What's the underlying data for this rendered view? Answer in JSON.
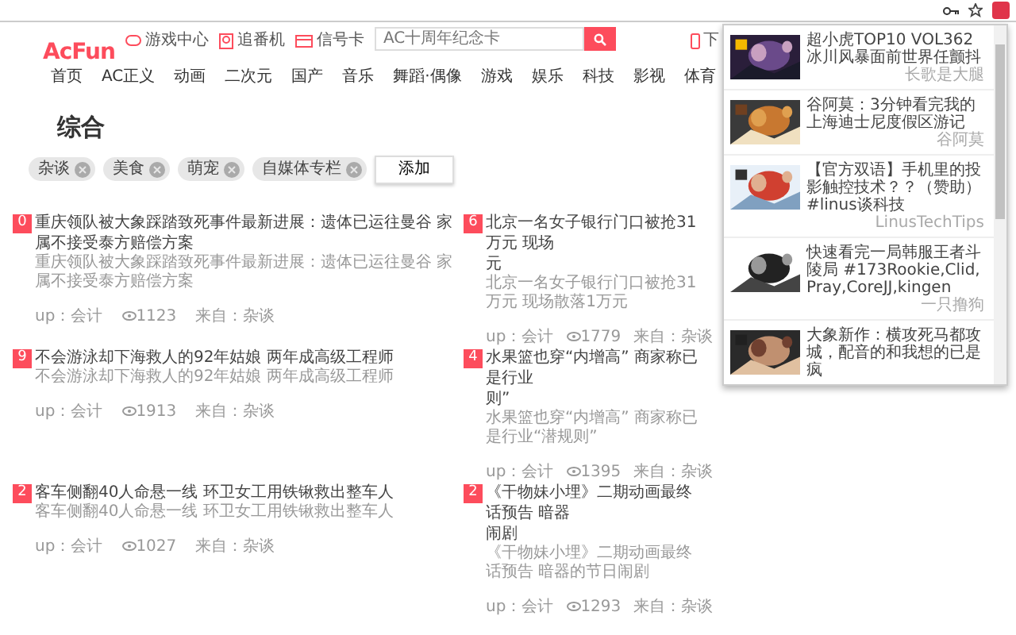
{
  "site": {
    "logo": "AcFun",
    "top_links": [
      "游戏中心",
      "追番机",
      "信号卡"
    ],
    "search_placeholder": "AC十周年纪念卡",
    "download": "下"
  },
  "nav": [
    "首页",
    "AC正义",
    "动画",
    "二次元",
    "国产",
    "音乐",
    "舞蹈·偶像",
    "游戏",
    "娱乐",
    "科技",
    "影视",
    "体育"
  ],
  "heading": "综合",
  "tags": [
    "杂谈",
    "美食",
    "萌宠",
    "自媒体专栏"
  ],
  "add_button": "添加",
  "articles": [
    {
      "rank": "0",
      "title_lines": [
        "重庆领队被大象踩踏致死事件最新进展：遗体已运往曼谷 家属不接受泰方赔偿方案"
      ],
      "desc": "重庆领队被大象踩踏致死事件最新进展：遗体已运往曼谷 家属不接受泰方赔偿方案",
      "up": "up：会计",
      "views": "1123",
      "source": "来自：杂谈"
    },
    {
      "rank": "6",
      "title_lines": [
        "北京一名女子银行门口被抢31万元 现场",
        "元"
      ],
      "desc": "北京一名女子银行门口被抢31万元 现场散落1万元",
      "up": "up：会计",
      "views": "1779",
      "source": "来自：杂谈"
    },
    {
      "rank": "9",
      "title_lines": [
        "不会游泳却下海救人的92年姑娘 两年成高级工程师"
      ],
      "desc": "不会游泳却下海救人的92年姑娘 两年成高级工程师",
      "up": "up：会计",
      "views": "1913",
      "source": "来自：杂谈"
    },
    {
      "rank": "4",
      "title_lines": [
        "水果篮也穿“内增高” 商家称已是行业",
        "则”"
      ],
      "desc": "水果篮也穿“内增高” 商家称已是行业“潜规则”",
      "up": "up：会计",
      "views": "1395",
      "source": "来自：杂谈"
    },
    {
      "rank": "2",
      "title_lines": [
        "客车侧翻40人命悬一线 环卫女工用铁锹救出整车人"
      ],
      "desc": "客车侧翻40人命悬一线 环卫女工用铁锹救出整车人",
      "up": "up：会计",
      "views": "1027",
      "source": "来自：杂谈"
    },
    {
      "rank": "2",
      "title_lines": [
        "《干物妹小埋》二期动画最终话预告 暗器",
        "闹剧"
      ],
      "desc": "《干物妹小埋》二期动画最终话预告 暗器的节日闹剧",
      "up": "up：会计",
      "views": "1293",
      "source": "来自：杂谈"
    }
  ],
  "popup": [
    {
      "title": "超小虎TOP10 VOL362 冰川风暴面前世界任颤抖",
      "author": "长歌是大腿"
    },
    {
      "title": "谷阿莫：3分钟看完我的上海迪士尼度假区游记",
      "author": "谷阿莫"
    },
    {
      "title": "【官方双语】手机里的投影触控技术？？（赞助）#linus谈科技",
      "author": "LinusTechTips"
    },
    {
      "title": "快速看完一局韩服王者斗陵局 #173Rookie,Clid,Pray,CoreJJ,kingen",
      "author": "一只撸狗"
    },
    {
      "title": "大象新作：横攻死马都攻城，配音的和我想的已是疯"
    }
  ]
}
